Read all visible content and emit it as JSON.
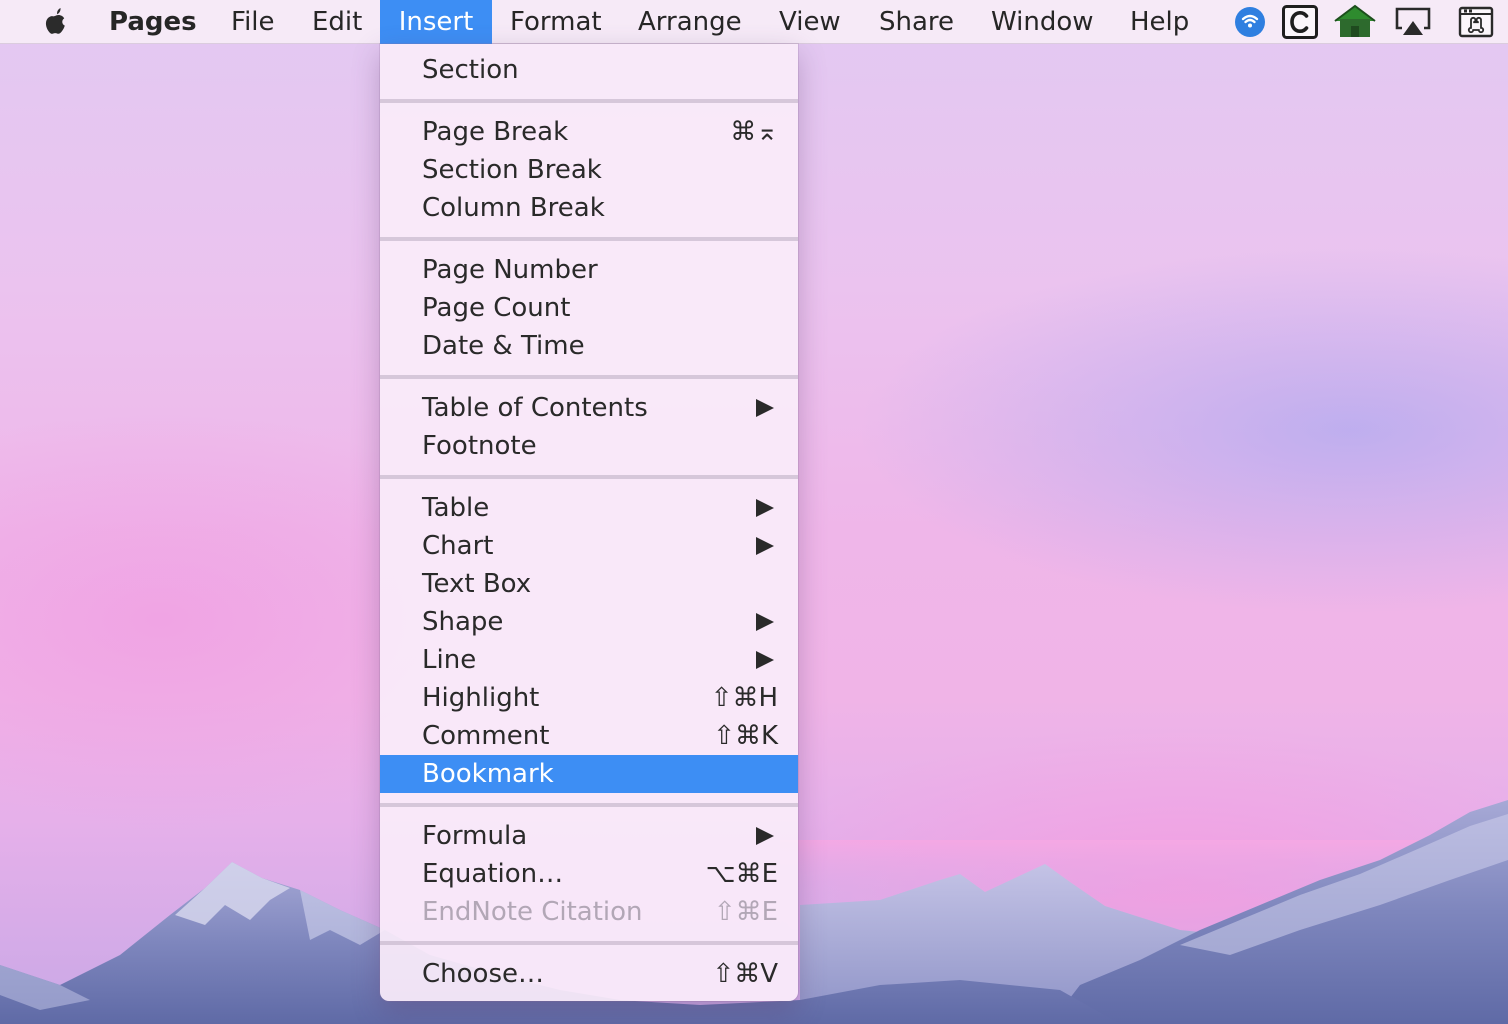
{
  "menubar": {
    "app_name": "Pages",
    "menus": [
      "File",
      "Edit",
      "Insert",
      "Format",
      "Arrange",
      "View",
      "Share",
      "Window",
      "Help"
    ],
    "active_menu": "Insert",
    "active_color": "#3d8ef4",
    "tray_icons": [
      "wifi-status-icon",
      "clipboard-c-icon",
      "green-house-icon",
      "airplay-icon",
      "command-keyboard-icon"
    ]
  },
  "insert_menu": {
    "section": {
      "label": "Section"
    },
    "page_break": {
      "label": "Page Break",
      "shortcut": "⌘⌅"
    },
    "section_break": {
      "label": "Section Break"
    },
    "column_break": {
      "label": "Column Break"
    },
    "page_number": {
      "label": "Page Number"
    },
    "page_count": {
      "label": "Page Count"
    },
    "date_time": {
      "label": "Date & Time"
    },
    "table_of_contents": {
      "label": "Table of Contents",
      "submenu": true
    },
    "footnote": {
      "label": "Footnote"
    },
    "table": {
      "label": "Table",
      "submenu": true
    },
    "chart": {
      "label": "Chart",
      "submenu": true
    },
    "text_box": {
      "label": "Text Box"
    },
    "shape": {
      "label": "Shape",
      "submenu": true
    },
    "line": {
      "label": "Line",
      "submenu": true
    },
    "highlight": {
      "label": "Highlight",
      "shortcut": "⇧⌘H"
    },
    "comment": {
      "label": "Comment",
      "shortcut": "⇧⌘K"
    },
    "bookmark": {
      "label": "Bookmark",
      "highlighted": true
    },
    "formula": {
      "label": "Formula",
      "submenu": true
    },
    "equation": {
      "label": "Equation…",
      "shortcut": "⌥⌘E"
    },
    "endnote_citation": {
      "label": "EndNote Citation",
      "shortcut": "⇧⌘E",
      "disabled": true
    },
    "choose": {
      "label": "Choose…",
      "shortcut": "⇧⌘V"
    }
  }
}
